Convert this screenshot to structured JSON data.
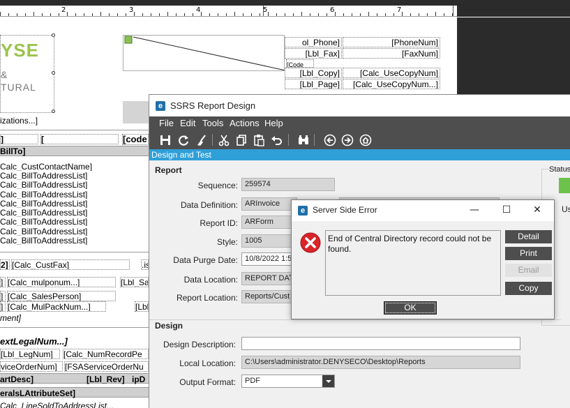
{
  "designer": {
    "ruler_numbers": [
      "2",
      "3",
      "4",
      "5",
      "6",
      "7"
    ],
    "logo": {
      "brand": "YSE",
      "line2": "&",
      "line3": "TURAL"
    },
    "fields": [
      "ol_Phone]",
      "[PhoneNum]",
      "[Lbl_Fax]",
      "[FaxNum]",
      "[Code",
      "[Lbl_Copy]",
      "[Calc_UseCopyNum]",
      "[Lbl_Page]",
      "[Calc_UseCopyNum...]",
      "izations...]",
      "]",
      "[",
      "[code",
      "BillTo]",
      "Calc_CustContactName]",
      "Calc_BillToAddressList]",
      "Calc_BillToAddressList]",
      "Calc_BillToAddressList]",
      "Calc_BillToAddressList]",
      "Calc_BillToAddressList]",
      "Calc_BillToAddressList]",
      "Calc_BillToAddressList]",
      "Calc_BillToAddressList]",
      "2]",
      "[Calc_CustFax]",
      ".is",
      "]",
      "[Calc_mulponum...]",
      "[Lbl_Sa",
      "]",
      "[Calc_SalesPerson]",
      "]",
      "[Calc_MulPackNum...]",
      "[Lbl",
      "ment]",
      "extLegalNum...]",
      "[Lbl_LegNum]",
      "[Calc_NumRecordPe",
      "viceOrderNum]",
      "[FSAServiceOrderNu",
      "artDesc]",
      "[Lbl_Rev]",
      "ipD",
      "eralsLAttributeSet]",
      "Calc_LineSoldToAddressList..."
    ]
  },
  "window": {
    "title": "SSRS Report Design",
    "app_icon_letter": "e",
    "menu": [
      "File",
      "Edit",
      "Tools",
      "Actions",
      "Help"
    ],
    "toolbar_icons": [
      "save-icon",
      "refresh-icon",
      "clear-icon",
      "cut-icon",
      "copy-icon",
      "paste-icon",
      "undo-icon",
      "find-icon",
      "back-icon",
      "forward-icon",
      "home-icon"
    ],
    "section_bar": "Design and Test",
    "report_group": "Report",
    "design_group": "Design",
    "fields": {
      "sequence": {
        "label": "Sequence:",
        "value": "259574"
      },
      "data_definition": {
        "label": "Data Definition:",
        "value": "ARInvoice"
      },
      "report_id": {
        "label": "Report ID:",
        "value": "ARForm"
      },
      "style": {
        "label": "Style:",
        "value": "1005"
      },
      "data_purge_date": {
        "label": "Data Purge Date:",
        "value": "10/8/2022 1:5"
      },
      "data_location": {
        "label": "Data Location:",
        "value": "REPORT DAT"
      },
      "report_location": {
        "label": "Report Location:",
        "value": "Reports/Cust"
      },
      "design_description": {
        "label": "Design Description:",
        "value": ""
      },
      "local_location": {
        "label": "Local Location:",
        "value": "C:\\Users\\administrator.DENYSECO\\Desktop\\Reports"
      },
      "output_format": {
        "label": "Output Format:",
        "value": "PDF"
      }
    },
    "status": {
      "label": "Status",
      "partial": "Us"
    }
  },
  "dialog": {
    "title": "Server Side Error",
    "app_icon_letter": "e",
    "minimize": "—",
    "maximize": "☐",
    "close": "✕",
    "message": "End of Central Directory record could not be found.",
    "buttons": {
      "detail": "Detail",
      "print": "Print",
      "email": "Email",
      "copy": "Copy",
      "ok": "OK"
    }
  },
  "colors": {
    "accent_bar": "#2f9fd8",
    "toolbar": "#4e4e4e",
    "brand_green": "#9bc34b",
    "error_red": "#d9242a",
    "status_green": "#6cc24a"
  }
}
